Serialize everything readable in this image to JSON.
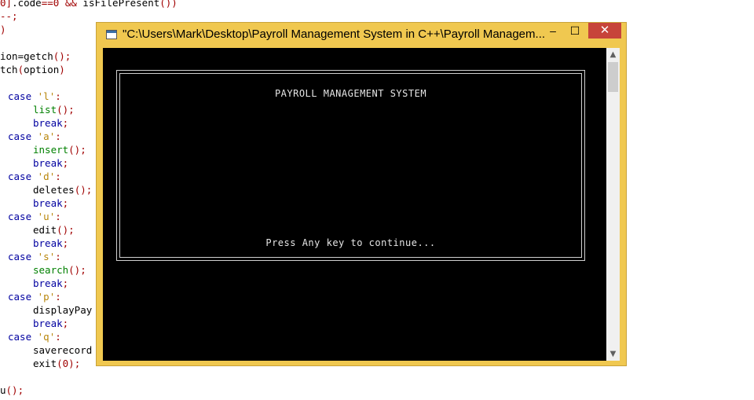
{
  "code_lines": [
    "0].code==0 && isFilePresent())",
    "--;",
    ")",
    "",
    "ion=getch();",
    "tch(option)",
    "",
    "  case 'l':",
    "       list();",
    "       break;",
    "  case 'a':",
    "       insert();",
    "       break;",
    "  case 'd':",
    "       deletes();",
    "       break;",
    "  case 'u':",
    "       edit();",
    "       break;",
    "  case 's':",
    "       search();",
    "       break;",
    "  case 'p':",
    "       displayPay",
    "       break;",
    "  case 'q':",
    "       saverecord",
    "       exit(0);",
    "",
    "u();"
  ],
  "window": {
    "title": "\"C:\\Users\\Mark\\Desktop\\Payroll Management System in C++\\Payroll Managem...",
    "minimize": "–",
    "maximize": "☐",
    "close": "✕"
  },
  "console": {
    "heading": "PAYROLL MANAGEMENT SYSTEM",
    "prompt": "Press Any key to continue..."
  },
  "scrollbar": {
    "up": "▲",
    "down": "▼"
  }
}
